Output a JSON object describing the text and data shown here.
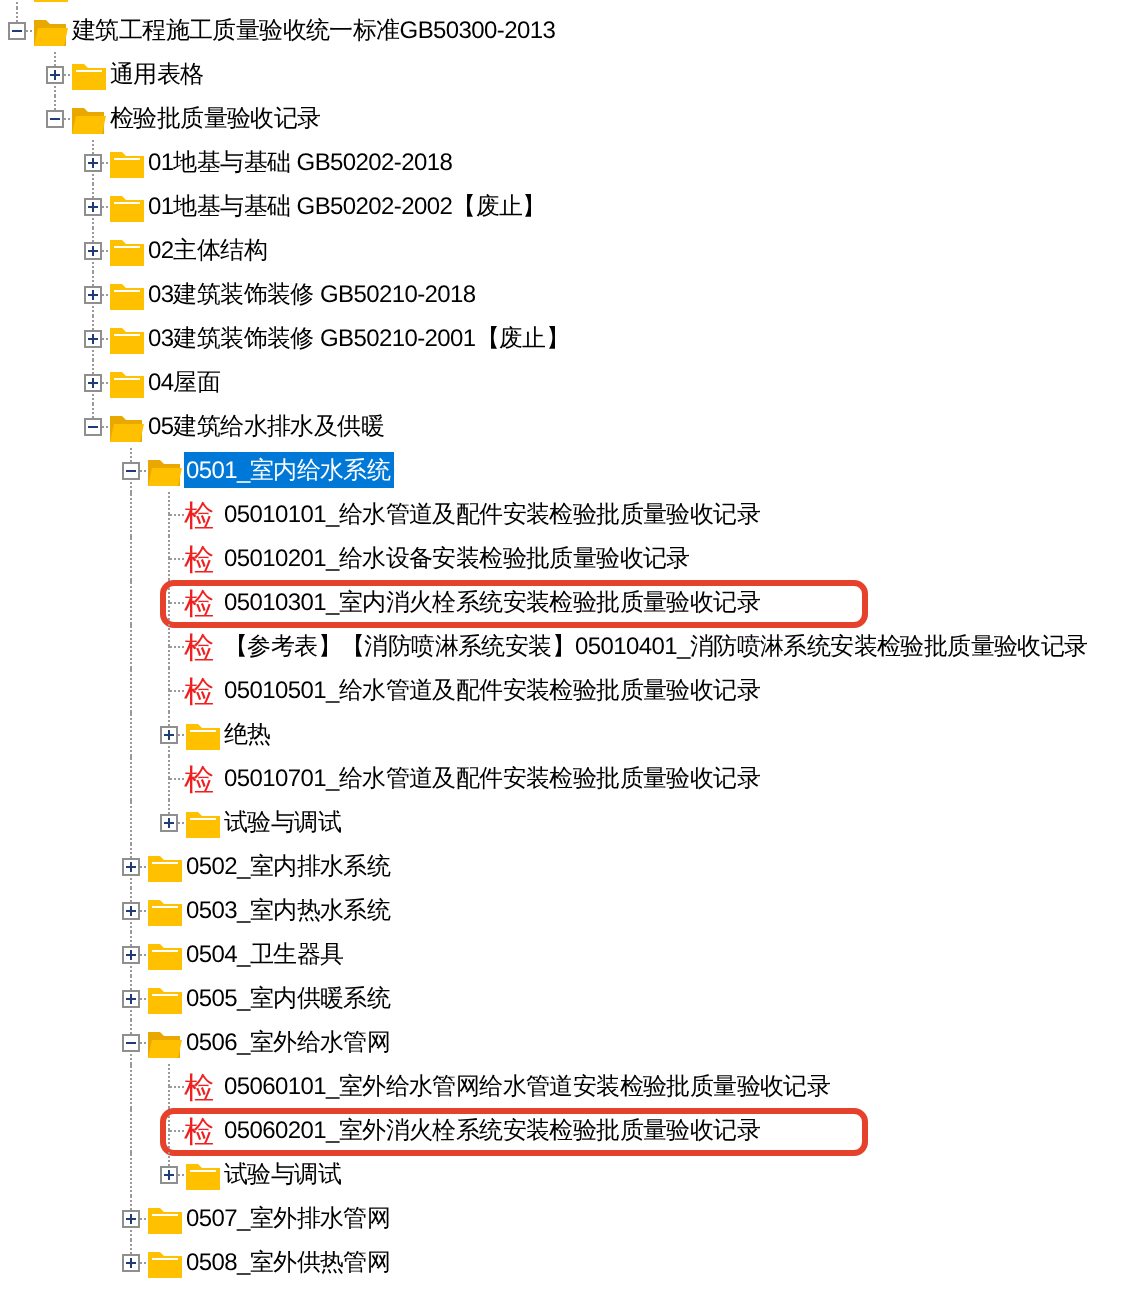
{
  "tree": [
    {
      "kind": "folder"
    },
    {
      "kind": "folder",
      "label": "建筑工程施工质量验收统一标准GB50300-2013",
      "expanded": true,
      "selected": false,
      "children": [
        {
          "kind": "folder",
          "label": "通用表格",
          "expanded": false,
          "selected": false
        },
        {
          "kind": "folder",
          "label": "检验批质量验收记录",
          "expanded": true,
          "selected": false,
          "children": [
            {
              "kind": "folder",
              "label": "01地基与基础 GB50202-2018",
              "expanded": false,
              "selected": false
            },
            {
              "kind": "folder",
              "label": "01地基与基础 GB50202-2002【废止】",
              "expanded": false,
              "selected": false
            },
            {
              "kind": "folder",
              "label": "02主体结构",
              "expanded": false,
              "selected": false
            },
            {
              "kind": "folder",
              "label": "03建筑装饰装修 GB50210-2018",
              "expanded": false,
              "selected": false
            },
            {
              "kind": "folder",
              "label": "03建筑装饰装修 GB50210-2001【废止】",
              "expanded": false,
              "selected": false
            },
            {
              "kind": "folder",
              "label": "04屋面",
              "expanded": false,
              "selected": false
            },
            {
              "kind": "folder",
              "label": "05建筑给水排水及供暖",
              "expanded": true,
              "selected": false,
              "children": [
                {
                  "kind": "folder",
                  "label": "0501_室内给水系统",
                  "expanded": true,
                  "selected": true,
                  "children": [
                    {
                      "kind": "record",
                      "badge": "检",
                      "label": "05010101_给水管道及配件安装检验批质量验收记录",
                      "selected": false,
                      "highlighted": false
                    },
                    {
                      "kind": "record",
                      "badge": "检",
                      "label": "05010201_给水设备安装检验批质量验收记录",
                      "selected": false,
                      "highlighted": false
                    },
                    {
                      "kind": "record",
                      "badge": "检",
                      "label": "05010301_室内消火栓系统安装检验批质量验收记录",
                      "selected": false,
                      "highlighted": true
                    },
                    {
                      "kind": "record",
                      "badge": "检",
                      "label": "【参考表】【消防喷淋系统安装】05010401_消防喷淋系统安装检验批质量验收记录",
                      "selected": false,
                      "highlighted": false
                    },
                    {
                      "kind": "record",
                      "badge": "检",
                      "label": "05010501_给水管道及配件安装检验批质量验收记录",
                      "selected": false,
                      "highlighted": false
                    },
                    {
                      "kind": "folder",
                      "label": "绝热",
                      "expanded": false,
                      "selected": false
                    },
                    {
                      "kind": "record",
                      "badge": "检",
                      "label": "05010701_给水管道及配件安装检验批质量验收记录",
                      "selected": false,
                      "highlighted": false
                    },
                    {
                      "kind": "folder",
                      "label": "试验与调试",
                      "expanded": false,
                      "selected": false
                    }
                  ]
                },
                {
                  "kind": "folder",
                  "label": "0502_室内排水系统",
                  "expanded": false,
                  "selected": false
                },
                {
                  "kind": "folder",
                  "label": "0503_室内热水系统",
                  "expanded": false,
                  "selected": false
                },
                {
                  "kind": "folder",
                  "label": "0504_卫生器具",
                  "expanded": false,
                  "selected": false
                },
                {
                  "kind": "folder",
                  "label": "0505_室内供暖系统",
                  "expanded": false,
                  "selected": false
                },
                {
                  "kind": "folder",
                  "label": "0506_室外给水管网",
                  "expanded": true,
                  "selected": false,
                  "children": [
                    {
                      "kind": "record",
                      "badge": "检",
                      "label": "05060101_室外给水管网给水管道安装检验批质量验收记录",
                      "selected": false,
                      "highlighted": false
                    },
                    {
                      "kind": "record",
                      "badge": "检",
                      "label": "05060201_室外消火栓系统安装检验批质量验收记录",
                      "selected": false,
                      "highlighted": true
                    },
                    {
                      "kind": "folder",
                      "label": "试验与调试",
                      "expanded": false,
                      "selected": false
                    }
                  ]
                },
                {
                  "kind": "folder",
                  "label": "0507_室外排水管网",
                  "expanded": false,
                  "selected": false
                },
                {
                  "kind": "folder",
                  "label": "0508_室外供热管网",
                  "expanded": false,
                  "selected": false
                }
              ]
            }
          ]
        }
      ]
    }
  ]
}
